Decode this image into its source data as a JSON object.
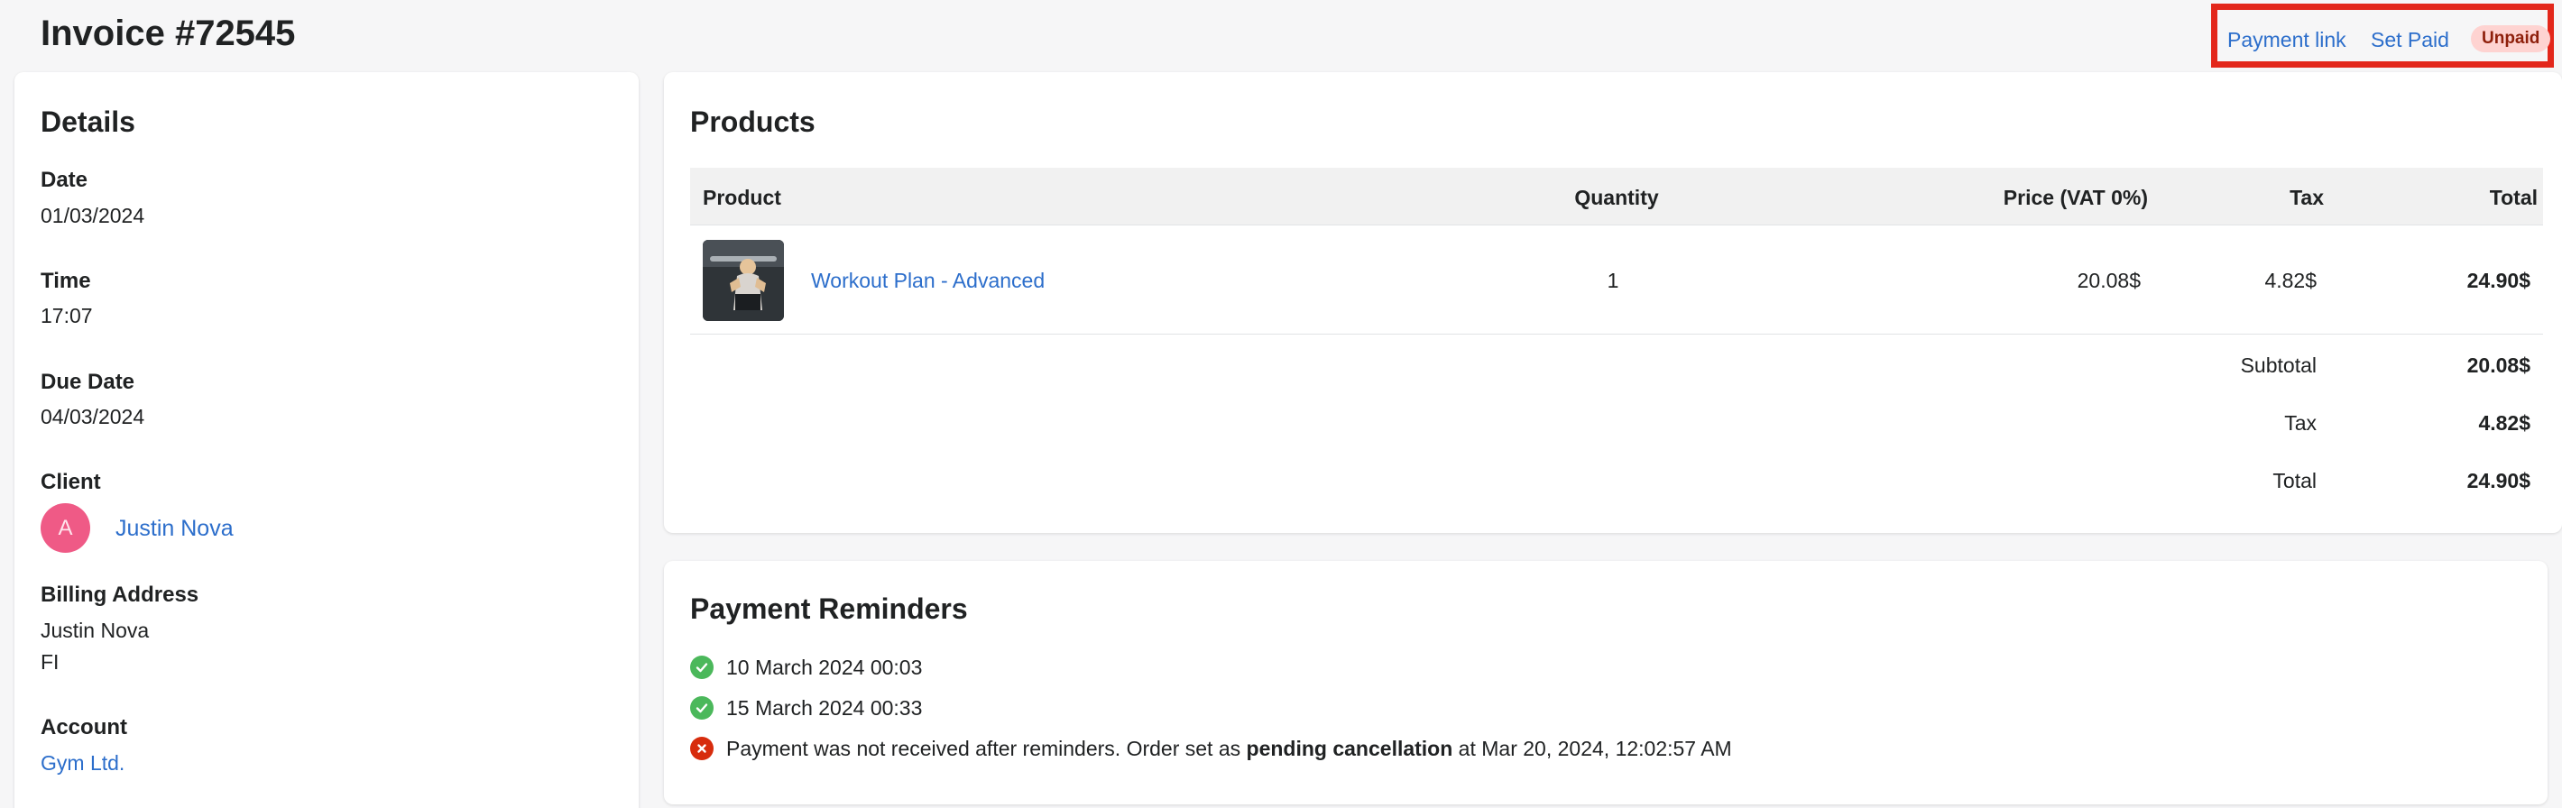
{
  "header": {
    "title": "Invoice #72545",
    "payment_link": "Payment link",
    "set_paid": "Set Paid",
    "status_badge": "Unpaid"
  },
  "details": {
    "title": "Details",
    "date_label": "Date",
    "date_value": "01/03/2024",
    "time_label": "Time",
    "time_value": "17:07",
    "due_label": "Due Date",
    "due_value": "04/03/2024",
    "client_label": "Client",
    "client_initial": "A",
    "client_name": "Justin Nova",
    "billing_label": "Billing Address",
    "billing_name": "Justin Nova",
    "billing_country": "FI",
    "account_label": "Account",
    "account_value": "Gym Ltd."
  },
  "products": {
    "title": "Products",
    "columns": {
      "product": "Product",
      "quantity": "Quantity",
      "price": "Price (VAT 0%)",
      "tax": "Tax",
      "total": "Total"
    },
    "rows": [
      {
        "name": "Workout Plan - Advanced",
        "quantity": "1",
        "price": "20.08$",
        "tax": "4.82$",
        "total": "24.90$"
      }
    ],
    "summary": {
      "subtotal_label": "Subtotal",
      "subtotal_value": "20.08$",
      "tax_label": "Tax",
      "tax_value": "4.82$",
      "total_label": "Total",
      "total_value": "24.90$"
    }
  },
  "reminders": {
    "title": "Payment Reminders",
    "items": [
      {
        "status": "sent",
        "text": "10 March 2024 00:03"
      },
      {
        "status": "sent",
        "text": "15 March 2024 00:33"
      }
    ],
    "failure": {
      "text_before": "Payment was not received after reminders. Order set as ",
      "highlight": "pending cancellation",
      "text_after": " at Mar 20, 2024, 12:02:57 AM"
    }
  },
  "colors": {
    "link": "#2c6ecb",
    "badge_bg": "#fed3d1",
    "badge_text": "#8e1f0b",
    "highlight_border": "#e3271b",
    "success": "#4bb85b",
    "error": "#d72c0d",
    "avatar": "#ef5a86"
  }
}
